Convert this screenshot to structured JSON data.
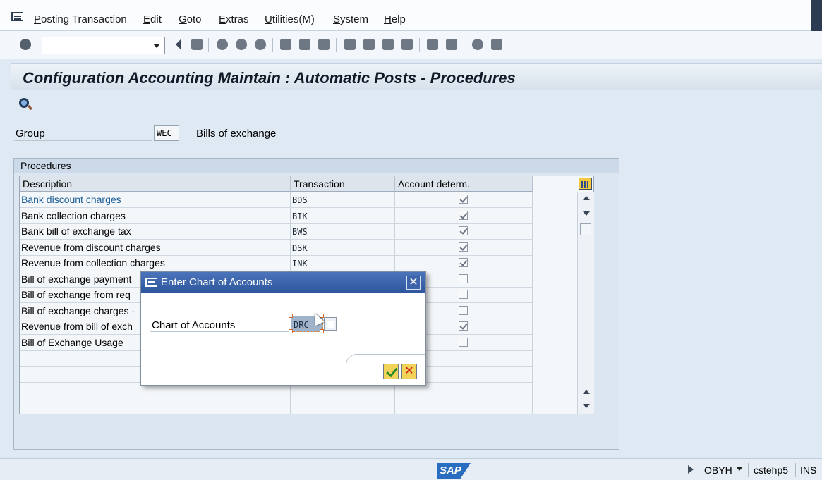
{
  "menu": [
    {
      "label": "Posting Transaction",
      "name": "menu-posting-transaction"
    },
    {
      "label": "Edit",
      "name": "menu-edit"
    },
    {
      "label": "Goto",
      "name": "menu-goto"
    },
    {
      "label": "Extras",
      "name": "menu-extras"
    },
    {
      "label": "Utilities(M)",
      "name": "menu-utilities"
    },
    {
      "label": "System",
      "name": "menu-system"
    },
    {
      "label": "Help",
      "name": "menu-help"
    }
  ],
  "command_field": {
    "value": ""
  },
  "screen_title": "Configuration Accounting Maintain : Automatic Posts - Procedures",
  "group": {
    "label": "Group",
    "value": "WEC",
    "description": "Bills of exchange"
  },
  "procedures": {
    "frame_title": "Procedures",
    "columns": [
      "Description",
      "Transaction",
      "Account determ."
    ],
    "rows": [
      {
        "description": "Bank discount charges",
        "transaction": "BDS",
        "checked": true
      },
      {
        "description": "Bank collection charges",
        "transaction": "BIK",
        "checked": true
      },
      {
        "description": "Bank bill of exchange tax",
        "transaction": "BWS",
        "checked": true
      },
      {
        "description": "Revenue from discount charges",
        "transaction": "DSK",
        "checked": true
      },
      {
        "description": "Revenue from collection charges",
        "transaction": "INK",
        "checked": true
      },
      {
        "description": "Bill of exchange payment",
        "transaction": "",
        "checked": false
      },
      {
        "description": "Bill of exchange from req",
        "transaction": "",
        "checked": false
      },
      {
        "description": "Bill of exchange charges -",
        "transaction": "",
        "checked": false
      },
      {
        "description": "Revenue from bill of exch",
        "transaction": "",
        "checked": true
      },
      {
        "description": "Bill of Exchange Usage",
        "transaction": "",
        "checked": false
      }
    ]
  },
  "dialog": {
    "title": "Enter Chart of Accounts",
    "field_label": "Chart of Accounts",
    "field_value": "DRC"
  },
  "status": {
    "logo": "SAP",
    "transaction": "OBYH",
    "server": "cstehp5",
    "mode": "INS"
  }
}
